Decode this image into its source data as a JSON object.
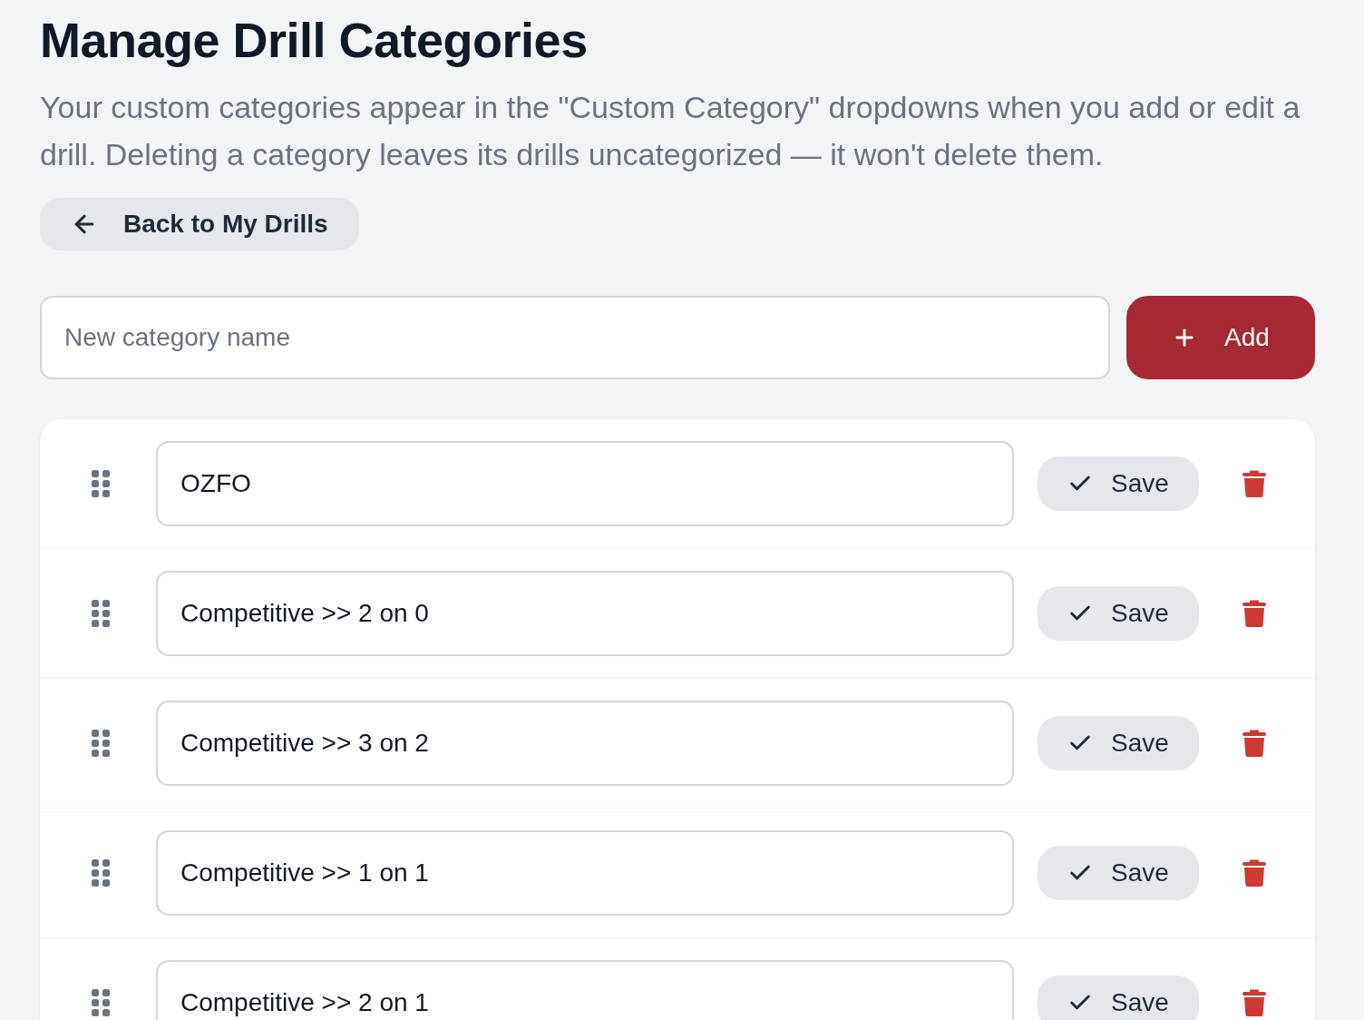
{
  "page": {
    "title": "Manage Drill Categories",
    "description": "Your custom categories appear in the \"Custom Category\" dropdowns when you add or edit a drill. Deleting a category leaves its drills uncategorized — it won't delete them."
  },
  "back_button": {
    "label": "Back to My Drills"
  },
  "new_category": {
    "placeholder": "New category name",
    "button": "Add"
  },
  "categories": [
    {
      "name": "OZFO",
      "action": "Save"
    },
    {
      "name": "Competitive >> 2 on 0",
      "action": "Save"
    },
    {
      "name": "Competitive >> 3 on 2",
      "action": "Save"
    },
    {
      "name": "Competitive >> 1 on 1",
      "action": "Save"
    },
    {
      "name": "Competitive >> 2 on 1",
      "action": "Save"
    }
  ]
}
